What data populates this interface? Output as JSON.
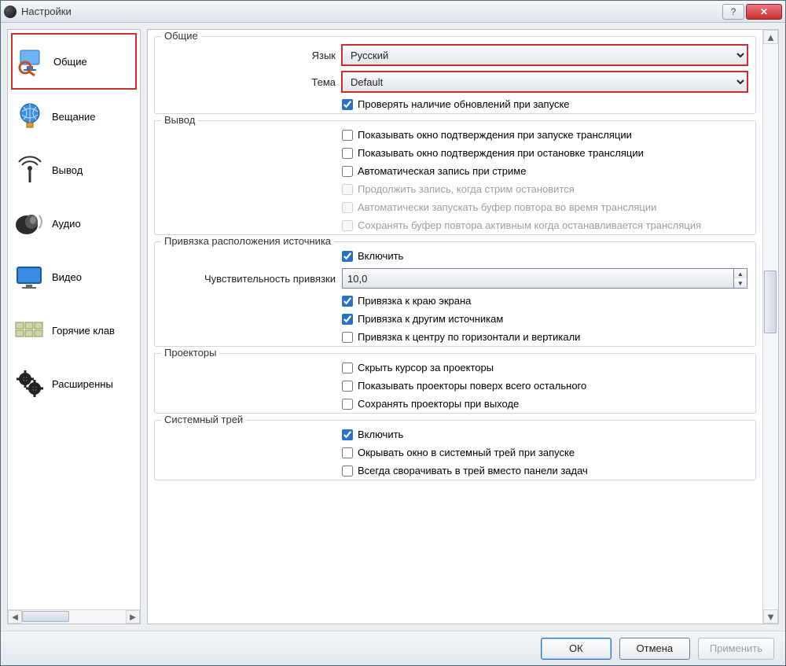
{
  "window": {
    "title": "Настройки"
  },
  "sidebar": {
    "items": [
      {
        "label": "Общие"
      },
      {
        "label": "Вещание"
      },
      {
        "label": "Вывод"
      },
      {
        "label": "Аудио"
      },
      {
        "label": "Видео"
      },
      {
        "label": "Горячие клав"
      },
      {
        "label": "Расширенны"
      }
    ]
  },
  "general": {
    "section_title": "Общие",
    "language_label": "Язык",
    "language_value": "Русский",
    "theme_label": "Тема",
    "theme_value": "Default",
    "check_updates": "Проверять наличие обновлений при запуске"
  },
  "output": {
    "section_title": "Вывод",
    "confirm_start": "Показывать окно подтверждения при запуске трансляции",
    "confirm_stop": "Показывать окно подтверждения при остановке трансляции",
    "auto_record": "Автоматическая запись при стриме",
    "continue_record": "Продолжить запись, когда стрим остановится",
    "auto_replay": "Автоматически запускать буфер повтора во время трансляции",
    "keep_replay": "Сохранять буфер повтора активным когда останавливается трансляция"
  },
  "snapping": {
    "section_title": "Привязка расположения источника",
    "enable": "Включить",
    "sensitivity_label": "Чувствительность привязки",
    "sensitivity_value": "10,0",
    "snap_edge": "Привязка к краю экрана",
    "snap_sources": "Привязка к другим источникам",
    "snap_center": "Привязка к центру по горизонтали и вертикали"
  },
  "projectors": {
    "section_title": "Проекторы",
    "hide_cursor": "Скрыть курсор за проекторы",
    "always_top": "Показывать проекторы поверх всего остального",
    "save_on_exit": "Сохранять проекторы при выходе"
  },
  "tray": {
    "section_title": "Системный трей",
    "enable": "Включить",
    "hide_to_tray": "Окрывать окно в системный трей при запуске",
    "minimize_to_tray": "Всегда сворачивать в трей вместо панели задач"
  },
  "footer": {
    "ok": "ОК",
    "cancel": "Отмена",
    "apply": "Применить"
  }
}
